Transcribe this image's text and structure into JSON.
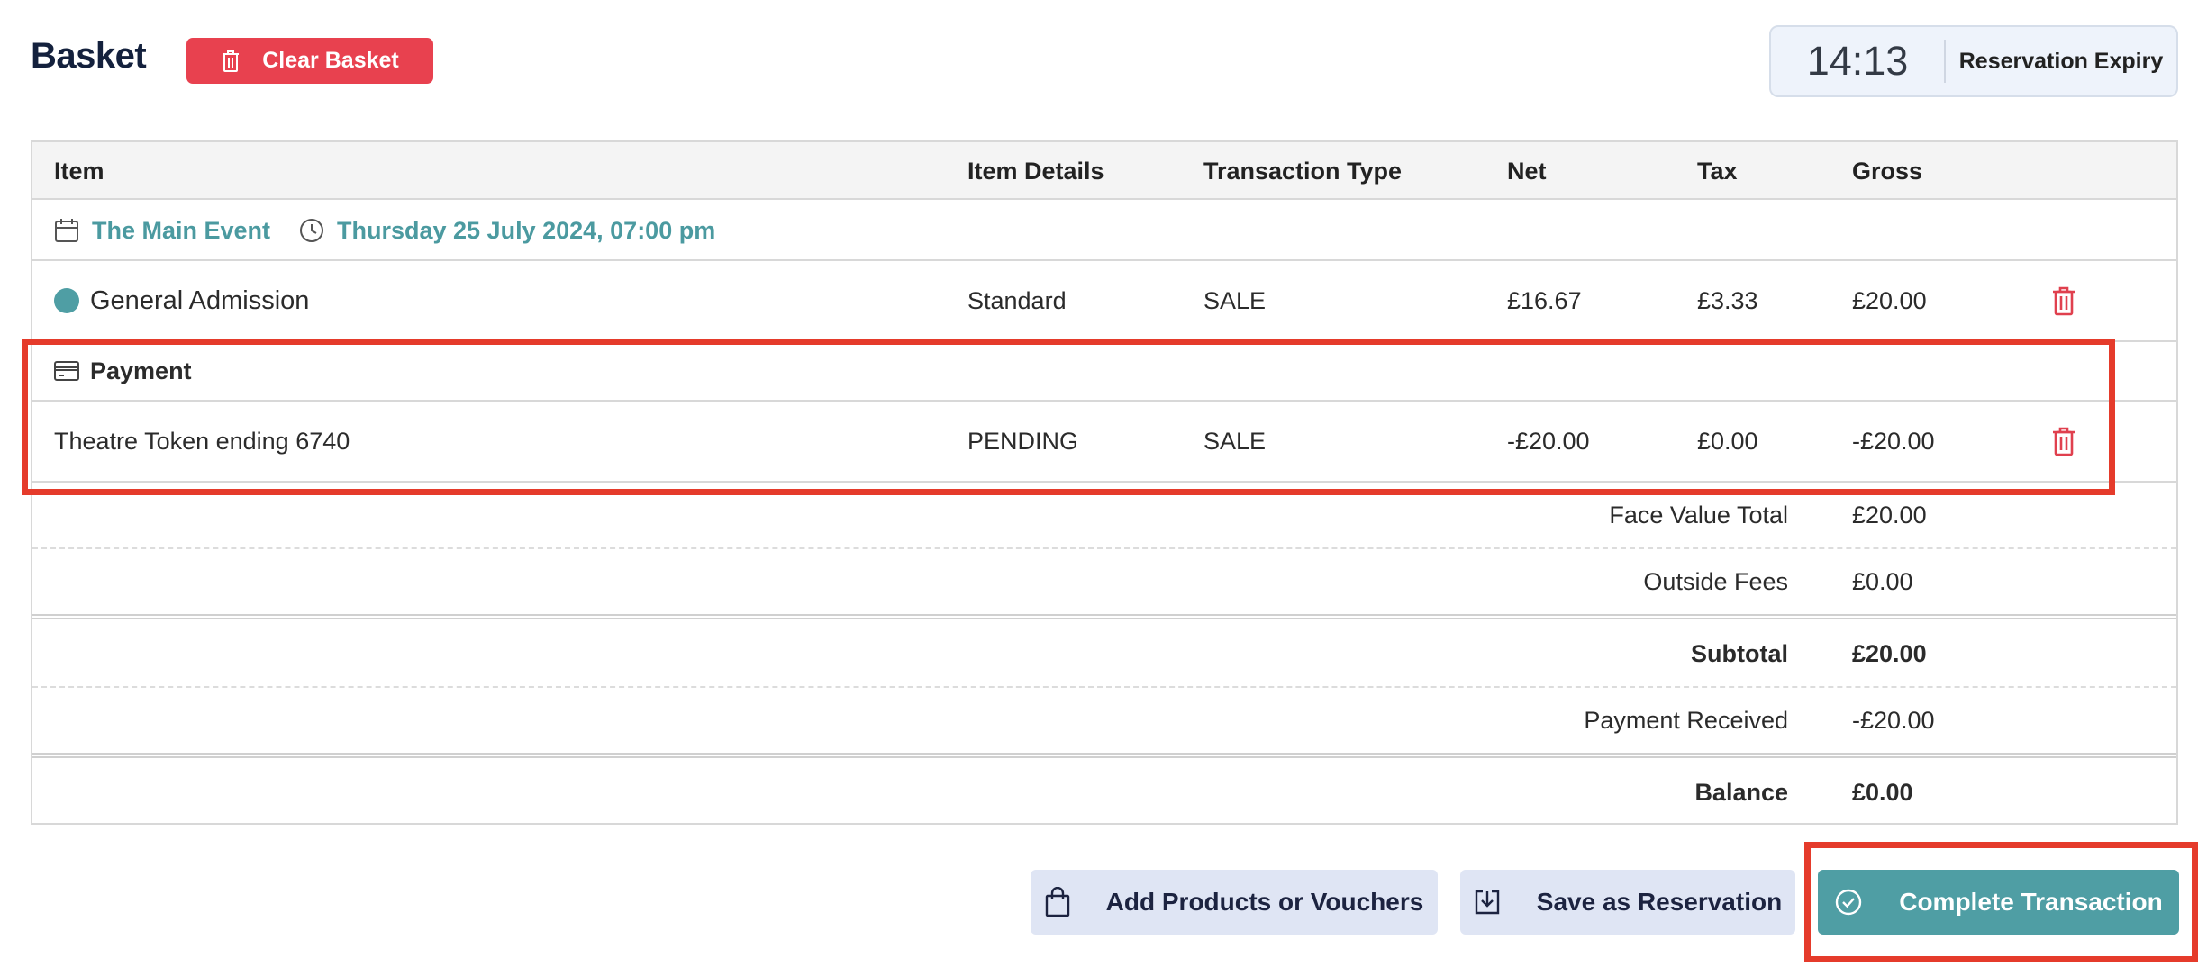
{
  "header": {
    "title": "Basket",
    "clear_label": "Clear Basket",
    "timer_value": "14:13",
    "timer_label": "Reservation Expiry"
  },
  "table": {
    "columns": [
      "Item",
      "Item Details",
      "Transaction Type",
      "Net",
      "Tax",
      "Gross"
    ],
    "event": {
      "name": "The Main Event",
      "datetime": "Thursday 25 July 2024, 07:00 pm"
    },
    "ticket_row": {
      "item": "General Admission",
      "details": "Standard",
      "type": "SALE",
      "net": "£16.67",
      "tax": "£3.33",
      "gross": "£20.00"
    },
    "payment_header": "Payment",
    "payment_row": {
      "item": "Theatre Token ending 6740",
      "details": "PENDING",
      "type": "SALE",
      "net": "-£20.00",
      "tax": "£0.00",
      "gross": "-£20.00"
    }
  },
  "totals": {
    "face_value_label": "Face Value Total",
    "face_value": "£20.00",
    "outside_fees_label": "Outside Fees",
    "outside_fees": "£0.00",
    "subtotal_label": "Subtotal",
    "subtotal": "£20.00",
    "payment_received_label": "Payment Received",
    "payment_received": "-£20.00",
    "balance_label": "Balance",
    "balance": "£0.00"
  },
  "actions": {
    "add_products": "Add Products or Vouchers",
    "save_reservation": "Save as Reservation",
    "complete": "Complete Transaction"
  },
  "colors": {
    "accent_teal": "#4f9ea4",
    "danger_red": "#e8414f",
    "highlight_red": "#e53b2b",
    "button_light": "#dfe5f4"
  },
  "icons": [
    "trash-icon",
    "calendar-icon",
    "clock-icon",
    "ticket-dot-icon",
    "card-icon",
    "shopping-bag-icon",
    "save-download-icon",
    "check-circle-icon"
  ]
}
